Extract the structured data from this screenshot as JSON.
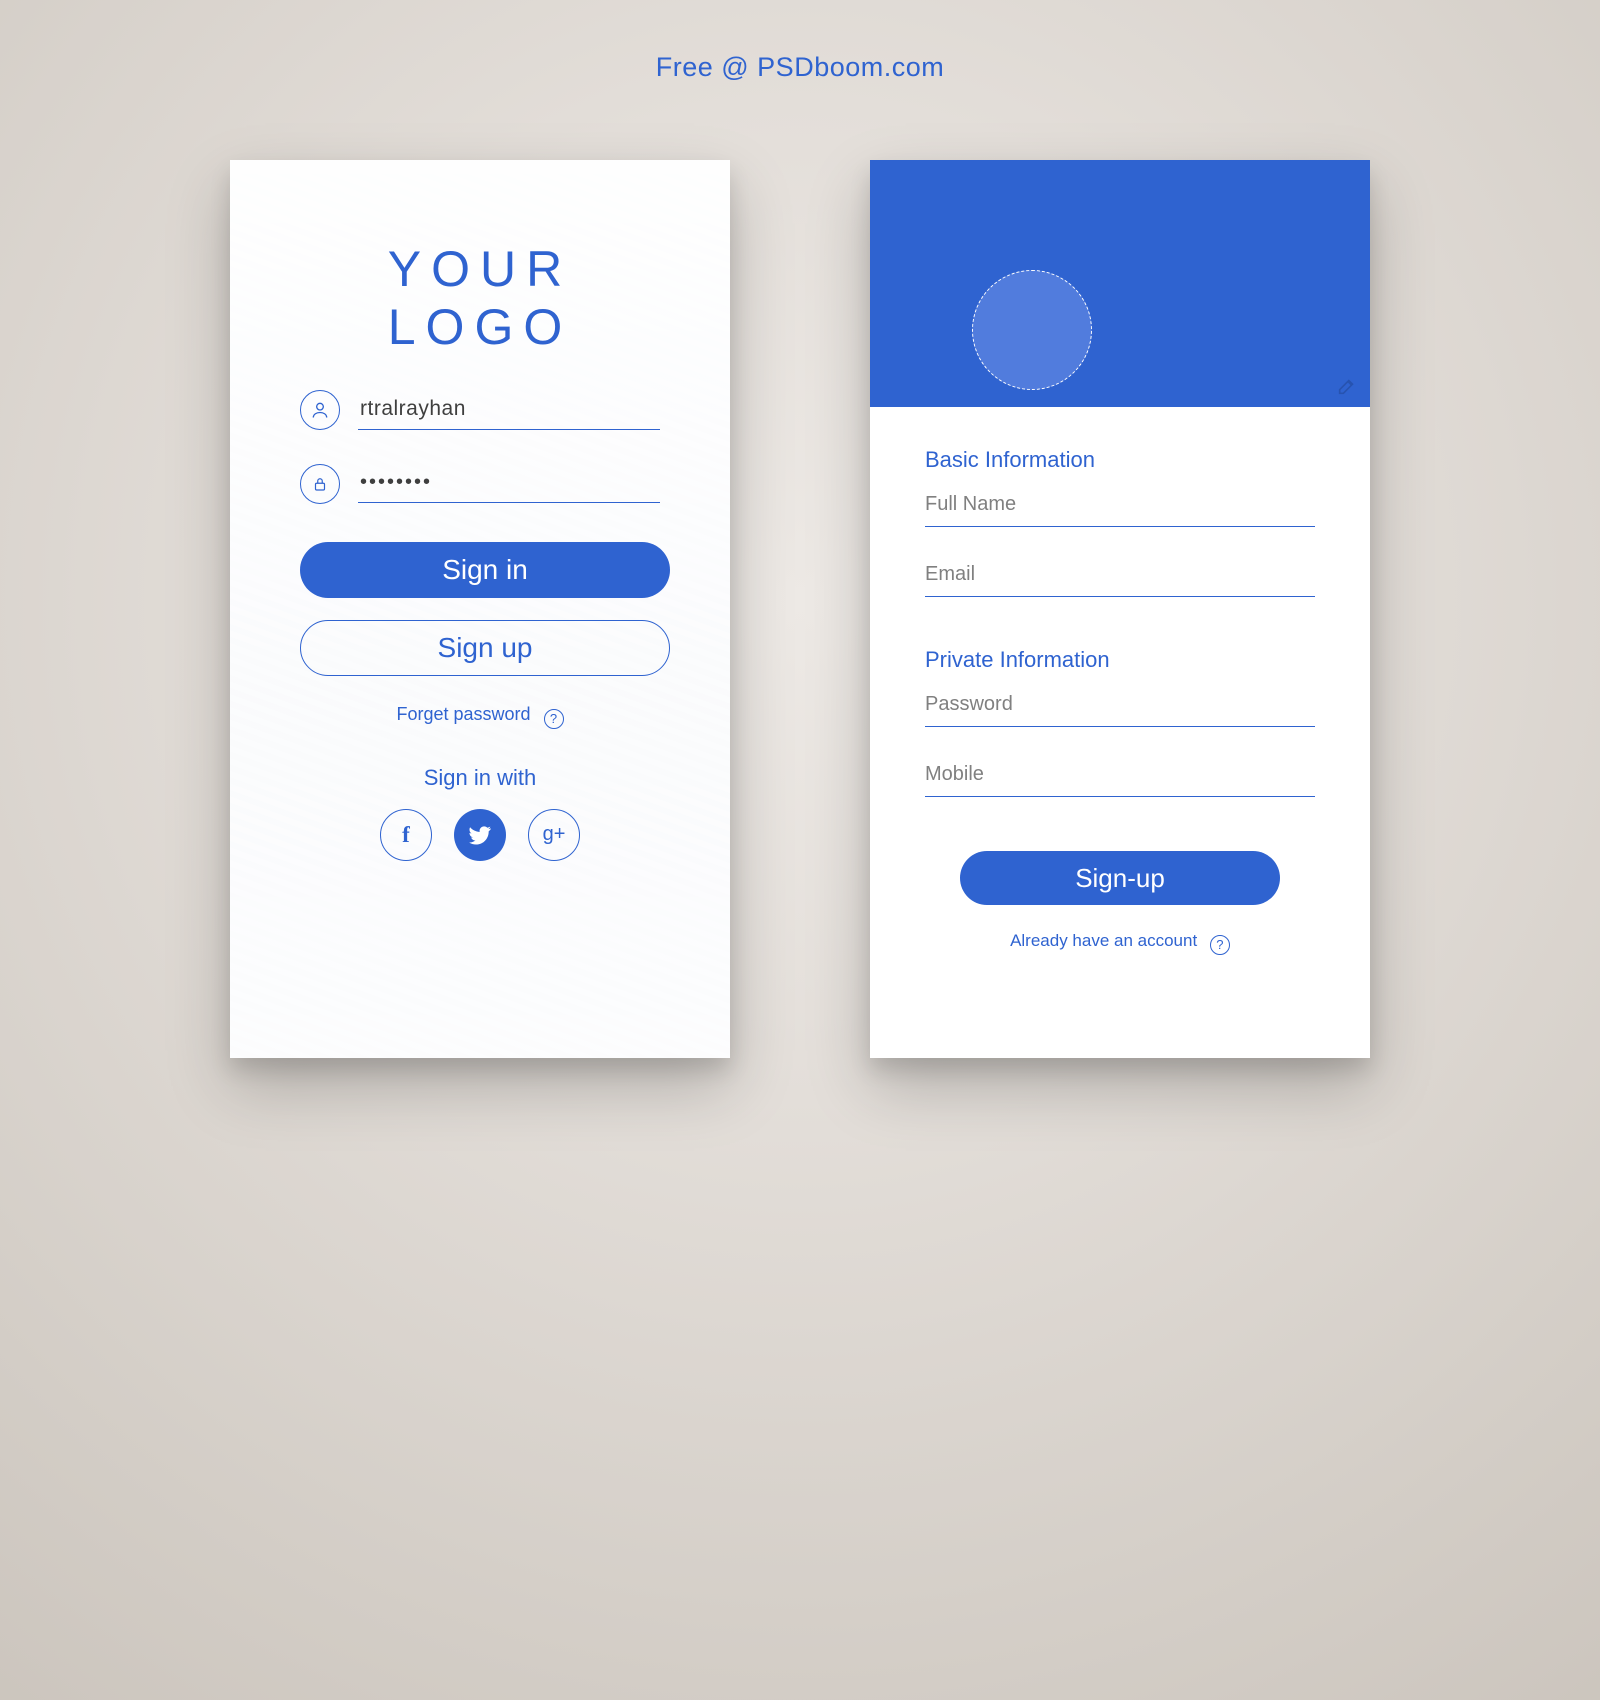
{
  "header": "Free @ PSDboom.com",
  "login": {
    "logo": "YOUR LOGO",
    "username_value": "rtralrayhan",
    "password_value": "••••••••",
    "signin_label": "Sign in",
    "signup_label": "Sign up",
    "forget_label": "Forget password",
    "social_title": "Sign in with",
    "social": {
      "fb": "f",
      "gp": "g+"
    }
  },
  "signup": {
    "basic_title": "Basic Information",
    "fullname_ph": "Full Name",
    "email_ph": "Email",
    "private_title": "Private Information",
    "password_ph": "Password",
    "mobile_ph": "Mobile",
    "button_label": "Sign-up",
    "already_label": "Already have an account"
  },
  "help_glyph": "?"
}
